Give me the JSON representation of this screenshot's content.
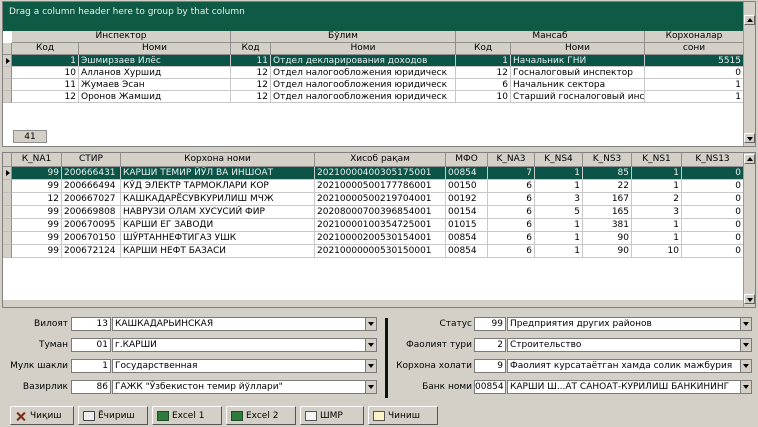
{
  "top_grid": {
    "group_panel_text": "Drag a column header here to group by that column",
    "bands": [
      "Инспектор",
      "Бўлим",
      "Мансаб",
      "Корхоналар"
    ],
    "columns": [
      "Код",
      "Номи",
      "Код",
      "Номи",
      "Код",
      "Номи",
      "сони"
    ],
    "rows": [
      [
        "1",
        "Эшмирзаев Илёс",
        "11",
        "Отдел декларирования доходов",
        "1",
        "Начальник ГНИ",
        "5515"
      ],
      [
        "10",
        "Алланов Хуршид",
        "12",
        "Отдел налогообложения юридическ",
        "12",
        "Госналоговый инспектор",
        "0"
      ],
      [
        "11",
        "Жумаев Эсан",
        "12",
        "Отдел налогообложения юридическ",
        "6",
        "Начальник сектора",
        "1"
      ],
      [
        "12",
        "Оронов Жамшид",
        "12",
        "Отдел налогообложения юридическ",
        "10",
        "Старший госналоговый инспек",
        "1"
      ]
    ],
    "footer_count": "41"
  },
  "mid_grid": {
    "columns": [
      "К_NA1",
      "СТИР",
      "Корхона номи",
      "Хисоб рақам",
      "МФО",
      "K_NA3",
      "K_NS4",
      "K_NS3",
      "K_NS1",
      "K_NS13"
    ],
    "rows": [
      [
        "99",
        "200666431",
        "КАРШИ ТЕМИР ЙЎЛ ВА ИНШОАТ",
        "20210000400305175001",
        "00854",
        "7",
        "1",
        "85",
        "1",
        "0"
      ],
      [
        "99",
        "200666494",
        "КЎД ЭЛЕКТР ТАРМОКЛАРИ КОР",
        "20210000500177786001",
        "00150",
        "6",
        "1",
        "22",
        "1",
        "0"
      ],
      [
        "12",
        "200667027",
        "КАШКАДАРЁСУВКУРИЛИШ МЧЖ",
        "20210000500219704001",
        "00192",
        "6",
        "3",
        "167",
        "2",
        "0"
      ],
      [
        "99",
        "200669808",
        "НАВРУЗИ ОЛАМ ХУСУСИЙ ФИР",
        "20208000700396854001",
        "00154",
        "6",
        "5",
        "165",
        "3",
        "0"
      ],
      [
        "99",
        "200670095",
        "КАРШИ ЕГ ЗАВОДИ",
        "20210000100354725001",
        "01015",
        "6",
        "1",
        "381",
        "1",
        "0"
      ],
      [
        "99",
        "200670150",
        "ШЎРТАННЕФТИГАЗ УШК",
        "20210000200530154001",
        "00854",
        "6",
        "1",
        "90",
        "1",
        "0"
      ],
      [
        "99",
        "200672124",
        "КАРШИ НЕФТ БАЗАСИ",
        "20210000000530150001",
        "00854",
        "6",
        "1",
        "90",
        "10",
        "0"
      ]
    ]
  },
  "filters_left": [
    {
      "label": "Вилоят",
      "code": "13",
      "value": "КАШКАДАРЬИНСКАЯ"
    },
    {
      "label": "Туман",
      "code": "01",
      "value": "г.КАРШИ"
    },
    {
      "label": "Мулк шакли",
      "code": "1",
      "value": "Государственная"
    },
    {
      "label": "Вазирлик",
      "code": "86",
      "value": "ГАЖК \"Ўзбекистон темир йўллари\""
    }
  ],
  "filters_right": [
    {
      "label": "Статус",
      "code": "99",
      "value": "Предприятия других районов"
    },
    {
      "label": "Фаолият тури",
      "code": "2",
      "value": "Строительство"
    },
    {
      "label": "Корхона холати",
      "code": "9",
      "value": "Фаолият курсатаётган хамда солик мажбурия"
    },
    {
      "label": "Банк номи",
      "code": "00854",
      "value": "КАРШИ Ш...АТ САНОАТ-КУРИЛИШ БАНКИНИНГ"
    }
  ],
  "toolbar": {
    "exit": "Чиқиш",
    "print": "Ёчириш",
    "excel1": "Excel 1",
    "excel2": "Excel 2",
    "wmp": "ШМР",
    "check": "Чиниш"
  },
  "colors": {
    "selected_row": "#0b5447",
    "group_panel": "#0f5a45",
    "window_bg": "#d4d0c8"
  }
}
